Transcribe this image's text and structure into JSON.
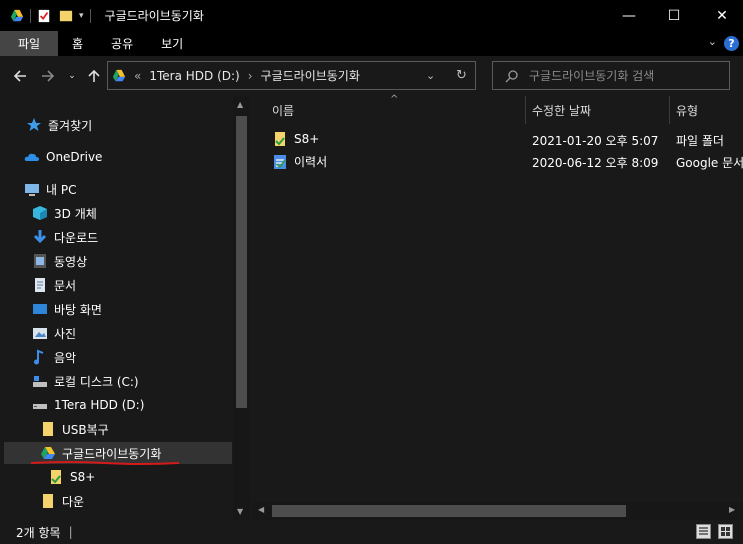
{
  "window": {
    "title": "구글드라이브동기화",
    "minimize": "—",
    "maximize": "☐",
    "close": "✕"
  },
  "ribbon": {
    "tabs": [
      "파일",
      "홈",
      "공유",
      "보기"
    ],
    "help": "?"
  },
  "address": {
    "prefix": "«",
    "drive": "1Tera HDD (D:)",
    "sep": "›",
    "folder": "구글드라이브동기화",
    "search_placeholder": "구글드라이브동기화 검색"
  },
  "nav": {
    "quick_access": "즐겨찾기",
    "onedrive": "OneDrive",
    "this_pc": "내 PC",
    "items": [
      {
        "label": "3D 개체",
        "icon": "3d-objects-icon"
      },
      {
        "label": "다운로드",
        "icon": "download-icon"
      },
      {
        "label": "동영상",
        "icon": "video-icon"
      },
      {
        "label": "문서",
        "icon": "document-icon"
      },
      {
        "label": "바탕 화면",
        "icon": "desktop-icon"
      },
      {
        "label": "사진",
        "icon": "pictures-icon"
      },
      {
        "label": "음악",
        "icon": "music-icon"
      },
      {
        "label": "로컬 디스크 (C:)",
        "icon": "drive-icon"
      },
      {
        "label": "1Tera HDD (D:)",
        "icon": "drive-icon"
      }
    ],
    "folders": [
      {
        "label": "USB복구"
      },
      {
        "label": "구글드라이브동기화"
      },
      {
        "label": "S8+"
      },
      {
        "label": "다운"
      }
    ]
  },
  "columns": {
    "name": "이름",
    "date": "수정한 날짜",
    "type": "유형"
  },
  "files": [
    {
      "name": "S8+",
      "date": "2021-01-20 오후 5:07",
      "type": "파일 폴더"
    },
    {
      "name": "이력서",
      "date": "2020-06-12 오후 8:09",
      "type": "Google 문서"
    }
  ],
  "status": {
    "count": "2개 항목"
  },
  "colors": {
    "background": "#191919",
    "titlebar": "#000000",
    "selected": "#333333",
    "accent": "#2b6fd4"
  }
}
